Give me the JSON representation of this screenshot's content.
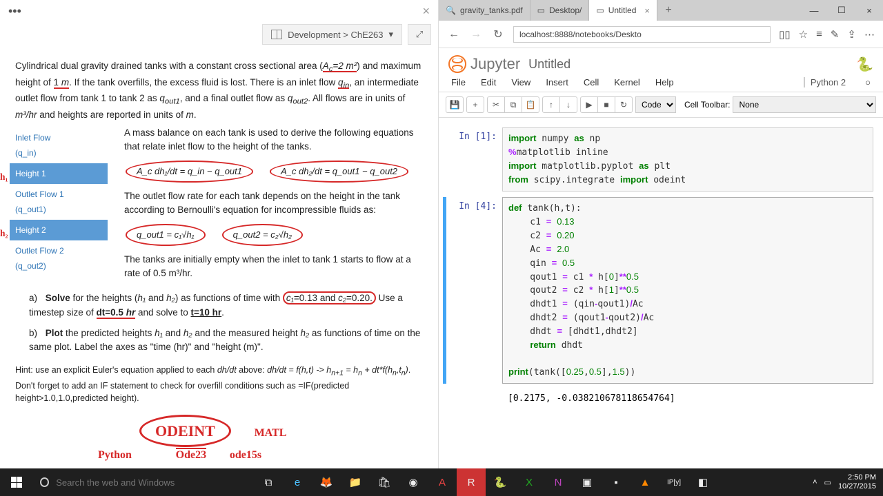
{
  "leftPane": {
    "breadcrumb": "Development > ChE263",
    "problem_intro": "Cylindrical dual gravity drained tanks with a constant cross sectional area (A_c=2 m²) and maximum height of 1 m. If the tank overfills, the excess fluid is lost. There is an inlet flow q_in, an intermediate outlet flow from tank 1 to tank 2 as q_out1, and a final outlet flow as q_out2. All flows are in units of m³/hr and heights are reported in units of m.",
    "diagram": {
      "inlet": "Inlet Flow",
      "qin": "(q_in)",
      "h1_box": "Height 1",
      "outlet1": "Outlet Flow 1",
      "qout1": "(q_out1)",
      "h2_box": "Height 2",
      "outlet2": "Outlet Flow 2",
      "qout2": "(q_out2)"
    },
    "mass_balance": "A mass balance on each tank is used to derive the following equations that relate inlet flow to the height of the tanks.",
    "eq1": "A_c dh₁/dt = q_in − q_out1",
    "eq2": "A_c dh₂/dt = q_out1 − q_out2",
    "bernoulli": "The outlet flow rate for each tank depends on the height in the tank according to Bernoulli's equation for incompressible fluids as:",
    "eq3": "q_out1 = c₁√h₁",
    "eq4": "q_out2 = c₂√h₂",
    "initial": "The tanks are initially empty when the inlet to tank 1 starts to flow at a rate of 0.5 m³/hr.",
    "part_a": "Solve for the heights (h₁ and h₂) as functions of time with c₁=0.13 and c₂=0.20. Use a timestep size of dt=0.5 hr and solve to t=10 hr.",
    "part_b": "Plot the predicted heights h₁ and h₂ and the measured height h₂ as functions of time on the same plot.  Label the axes as \"time (hr)\" and \"height (m)\".",
    "hint": "Hint: use an explicit Euler's equation applied to each dh/dt above: dh/dt = f(h,t) -> h_{n+1} = h_n + dt*f(h_n,t_n). Don't forget to add an IF statement to check for overfill conditions such as =IF(predicted height>1.0,1.0,predicted height).",
    "annot_odeint": "ODEINT",
    "annot_python": "Python",
    "annot_matl": "MATL",
    "annot_ode23": "Ode23",
    "annot_ode15s": "ode15s",
    "annot_h1": "h₁",
    "annot_h2": "h₂"
  },
  "browser": {
    "tabs": [
      {
        "label": "gravity_tanks.pdf",
        "active": false
      },
      {
        "label": "Desktop/",
        "active": false
      },
      {
        "label": "Untitled",
        "active": true
      }
    ],
    "url": "localhost:8888/notebooks/Deskto"
  },
  "jupyter": {
    "title": "Untitled",
    "kernel": "Python 2",
    "menus": [
      "File",
      "Edit",
      "View",
      "Insert",
      "Cell",
      "Kernel",
      "Help"
    ],
    "cell_type": "Code",
    "cell_toolbar_label": "Cell Toolbar:",
    "cell_toolbar_value": "None",
    "cells": [
      {
        "prompt": "In [1]:",
        "code_html": "<span class='kw'>import</span> numpy <span class='kw'>as</span> np\n<span class='op'>%</span>matplotlib inline\n<span class='kw'>import</span> matplotlib.pyplot <span class='kw'>as</span> plt\n<span class='kw'>from</span> scipy.integrate <span class='kw'>import</span> odeint"
      },
      {
        "prompt": "In [4]:",
        "active": true,
        "code_html": "<span class='kw'>def</span> tank(h,t):\n    c1 <span class='op'>=</span> <span class='num'>0.13</span>\n    c2 <span class='op'>=</span> <span class='num'>0.20</span>\n    Ac <span class='op'>=</span> <span class='num'>2.0</span>\n    qin <span class='op'>=</span> <span class='num'>0.5</span>\n    qout1 <span class='op'>=</span> c1 <span class='op'>*</span> h[<span class='num'>0</span>]<span class='op'>**</span><span class='num'>0.5</span>\n    qout2 <span class='op'>=</span> c2 <span class='op'>*</span> h[<span class='num'>1</span>]<span class='op'>**</span><span class='num'>0.5</span>\n    dhdt1 <span class='op'>=</span> (qin<span class='op'>-</span>qout1)<span class='op'>/</span>Ac\n    dhdt2 <span class='op'>=</span> (qout1<span class='op'>-</span>qout2)<span class='op'>/</span>Ac\n    dhdt <span class='op'>=</span> [dhdt1,dhdt2]\n    <span class='kw'>return</span> dhdt\n\n<span class='kw'>print</span>(tank([<span class='num'>0.25</span>,<span class='num'>0.5</span>],<span class='num'>1.5</span>))",
        "output": "[0.2175, -0.038210678118654764]"
      }
    ]
  },
  "taskbar": {
    "search_placeholder": "Search the web and Windows",
    "time": "2:50 PM",
    "date": "10/27/2015"
  }
}
